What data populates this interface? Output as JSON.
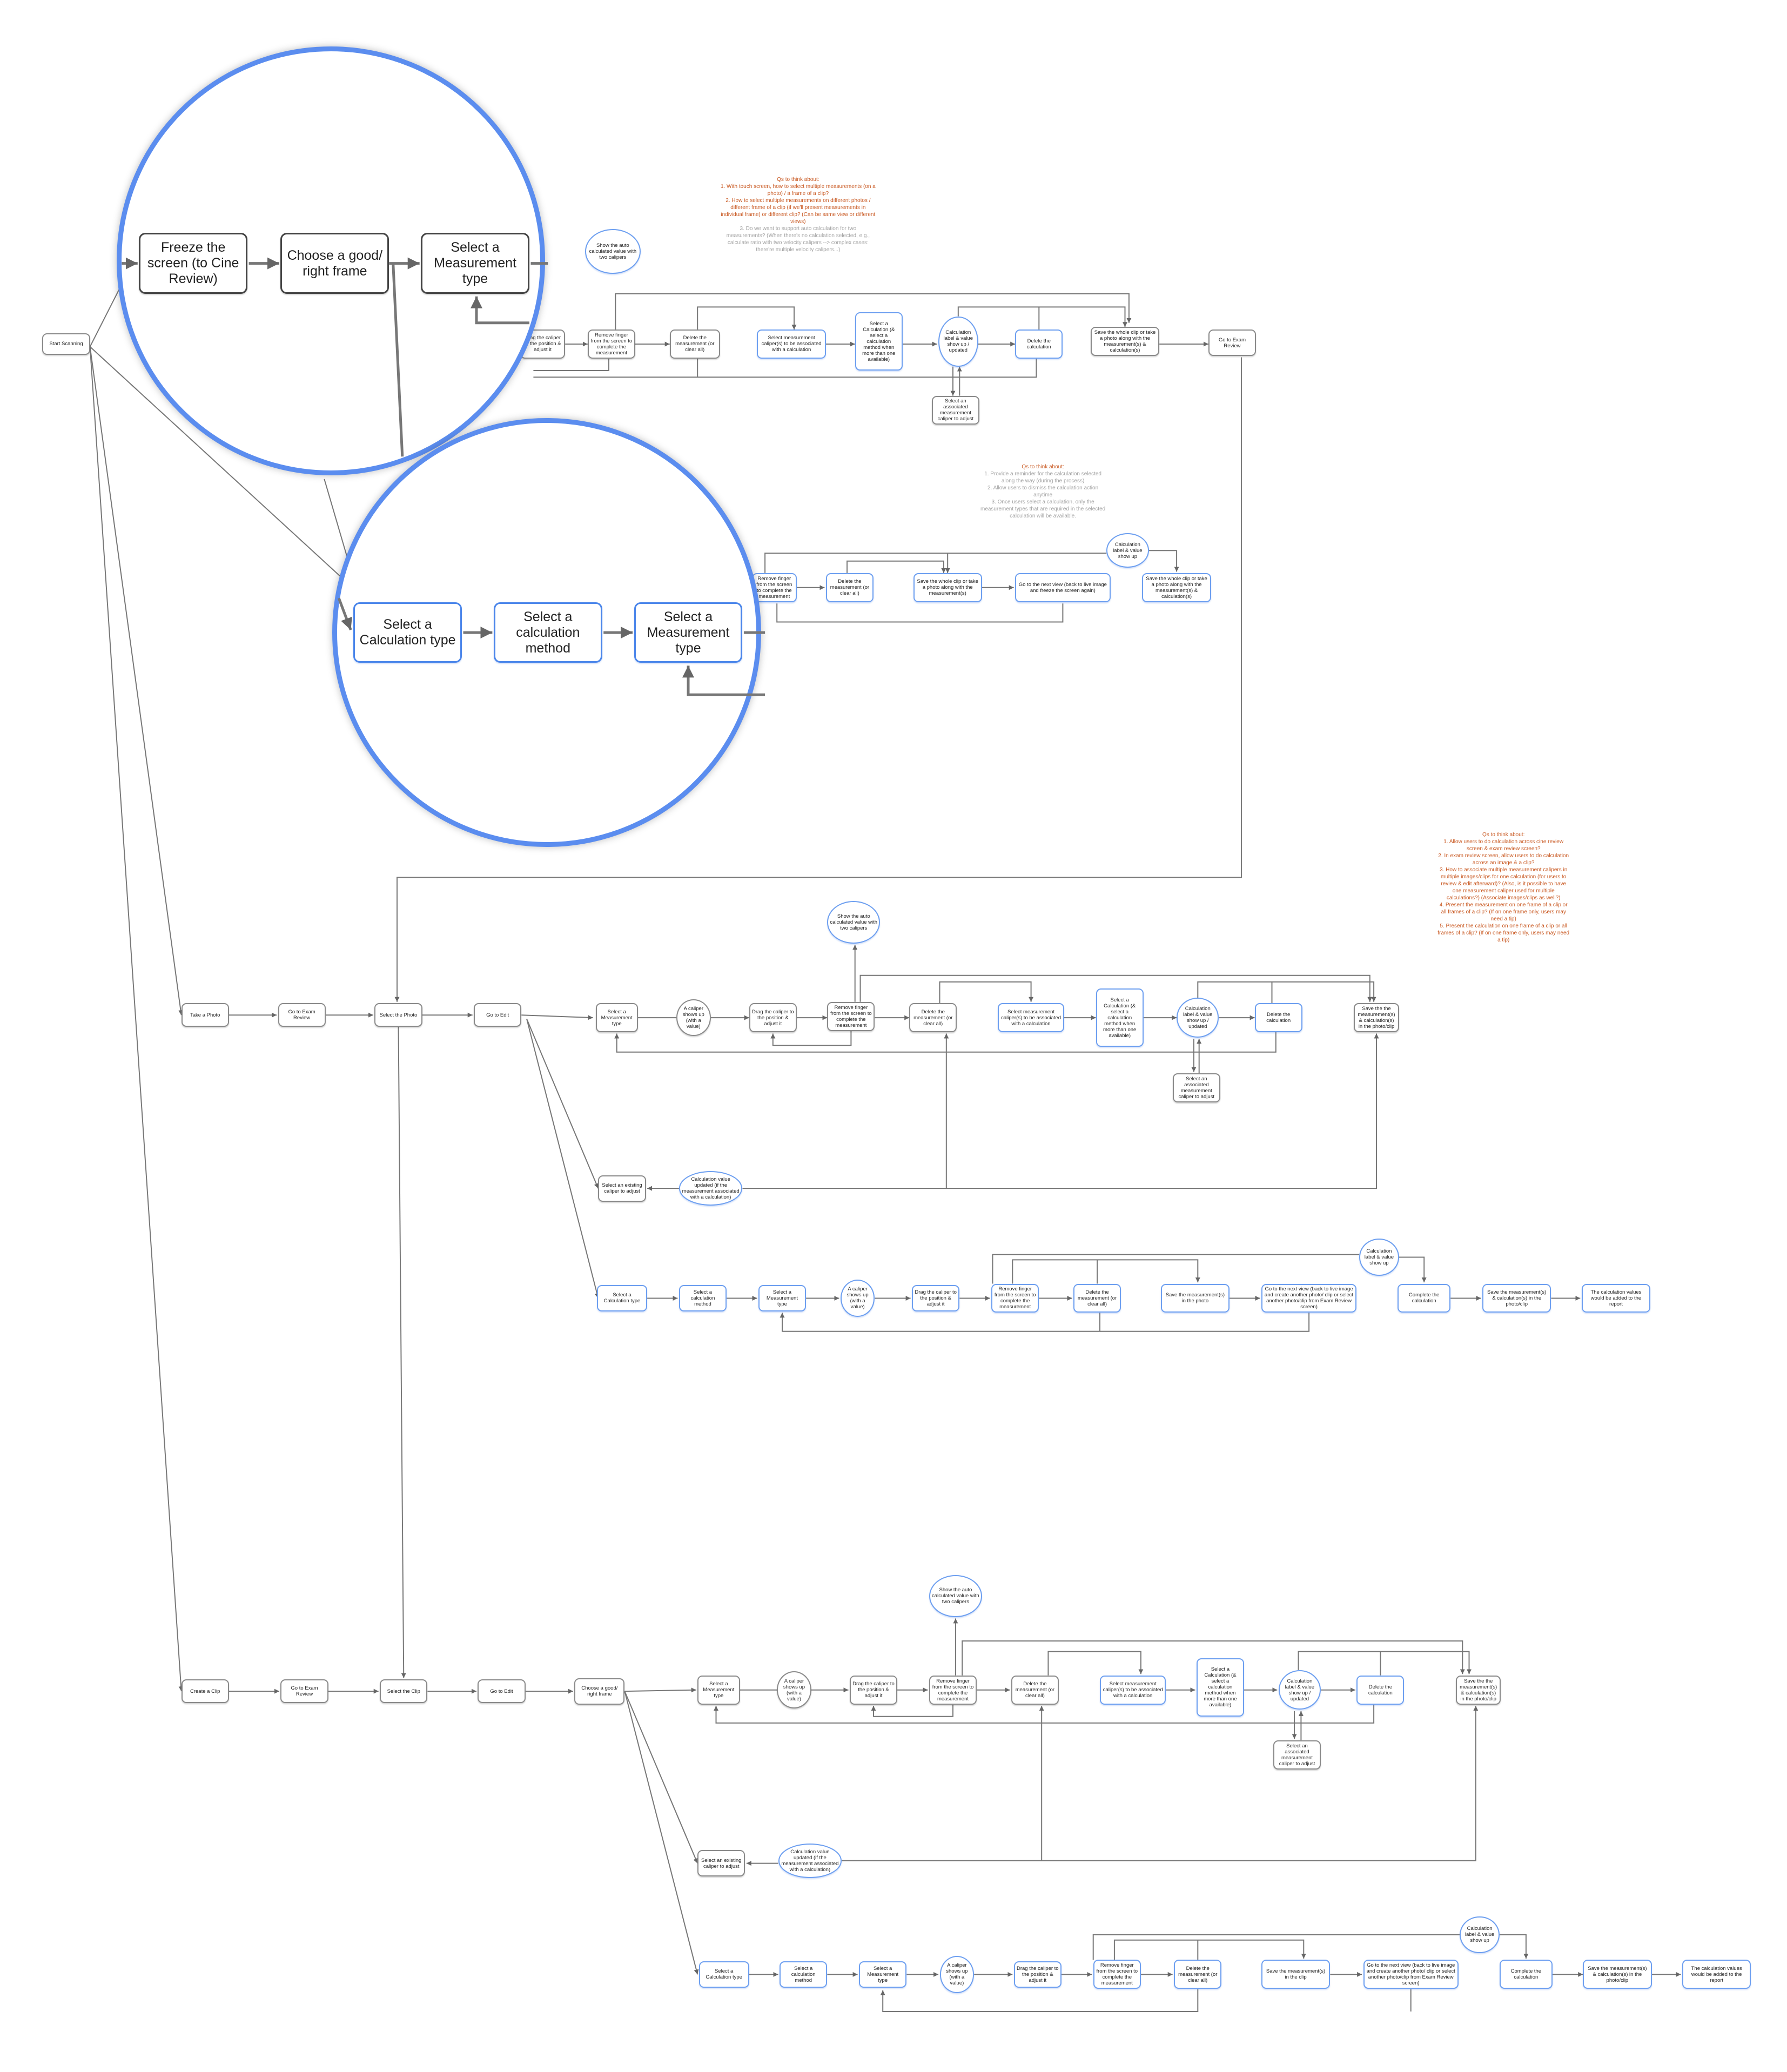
{
  "colors": {
    "lens": "#5b8def",
    "node_border": "#8a8a8a",
    "node_highlight": "#6d9ff0",
    "note_open": "#c8561e",
    "note_muted": "#a0a0a0"
  },
  "nodes": {
    "start": "Start Scanning",
    "t_drag": "Drag the caliper to the position & adjust it",
    "t_remove": "Remove finger from the screen to complete the measurement",
    "t_delete": "Delete the measurement (or clear all)",
    "t_auto": "Show the auto calculated value with two calipers",
    "t_selcal": "Select measurement caliper(s) to be associated with a calculation",
    "t_calc": "Select a Calculation (& select a calculation method when more than one available)",
    "t_label": "Calculation label & value show up / updated",
    "t_delcalc": "Delete the calculation",
    "t_save": "Save the whole clip or take a photo along with the measurement(s) & calculation(s)",
    "t_exam": "Go to Exam Review",
    "t_assoc": "Select an associated measurement caliper to adjust",
    "s_remove": "Remove finger from the screen to complete the measurement",
    "s_delete": "Delete the measurement (or clear all)",
    "s_save": "Save the whole clip or take a photo along with the measurement(s)",
    "s_next": "Go to the next view (back to live image and freeze the screen again)",
    "s_label": "Calculation label & value show up",
    "s_save2": "Save the whole clip or take a photo along with the measurement(s) & calculation(s)",
    "take_photo": "Take a Photo",
    "p_exam": "Go to Exam Review",
    "p_select": "Select the Photo",
    "p_edit": "Go to Edit",
    "p_mtype": "Select a Measurement type",
    "p_caliper": "A caliper shows up (with a value)",
    "p_drag": "Drag the caliper to the position & adjust it",
    "p_remove": "Remove finger from the screen to complete the measurement",
    "p_delete": "Delete the measurement (or clear all)",
    "p_auto": "Show the auto calculated value with two calipers",
    "p_selcal": "Select measurement caliper(s) to be associated with a calculation",
    "p_calc": "Select a Calculation (& select a calculation method when more than one available)",
    "p_label": "Calculation label & value show up / updated",
    "p_delcalc": "Delete the calculation",
    "p_save": "Save the the measurement(s) & calculation(s) in the photo/clip",
    "p_assoc": "Select an associated measurement caliper to adjust",
    "p_existing": "Select an existing caliper to adjust",
    "p_updated": "Calculation value updated (if the measurement associated with a calculation)",
    "pc_type": "Select a Calculation type",
    "pc_method": "Select a calculation method",
    "pc_mtype": "Select a Measurement type",
    "pc_caliper": "A caliper shows up (with a value)",
    "pc_drag": "Drag the caliper to the position & adjust it",
    "pc_remove": "Remove finger from the screen to complete the measurement",
    "pc_delete": "Delete the measurement (or clear all)",
    "pc_save": "Save the measurement(s) in the photo",
    "pc_next": "Go to the next view (back to live image and create another photo/ clip or select another photo/clip from Exam Review screen)",
    "pc_label": "Calculation label & value show up",
    "pc_complete": "Complete the calculation",
    "pc_save2": "Save the measurement(s) & calculation(s) in the photo/clip",
    "pc_report": "The calculation values would be added to the report",
    "create_clip": "Create a Clip",
    "c_exam": "Go to Exam Review",
    "c_select": "Select the Clip",
    "c_edit": "Go to Edit",
    "c_frame": "Choose a good/ right frame",
    "c_mtype": "Select a Measurement type",
    "c_caliper": "A caliper shows up (with a value)",
    "c_drag": "Drag the caliper to the position & adjust it",
    "c_remove": "Remove finger from the screen to complete the measurement",
    "c_delete": "Delete the measurement (or clear all)",
    "c_auto": "Show the auto calculated value with two calipers",
    "c_selcal": "Select measurement caliper(s) to be associated with a calculation",
    "c_calc": "Select a Calculation (& select a calculation method when more than one available)",
    "c_label": "Calculation label & value show up / updated",
    "c_delcalc": "Delete the calculation",
    "c_save": "Save the the measurement(s) & calculation(s) in the photo/clip",
    "c_assoc": "Select an associated measurement caliper to adjust",
    "c_existing": "Select an existing caliper to adjust",
    "c_updated": "Calculation value updated (if the measurement associated with a calculation)",
    "cc_type": "Select a Calculation type",
    "cc_method": "Select a calculation method",
    "cc_mtype": "Select a Measurement type",
    "cc_caliper": "A caliper shows up (with a value)",
    "cc_drag": "Drag the caliper to the position & adjust it",
    "cc_remove": "Remove finger from the screen to complete the measurement",
    "cc_delete": "Delete the measurement (or clear all)",
    "cc_save": "Save the measurement(s) in the clip",
    "cc_next": "Go to the next view (back to live image and create another photo/ clip or select another photo/clip from Exam Review screen)",
    "cc_label": "Calculation label & value show up",
    "cc_complete": "Complete the calculation",
    "cc_save2": "Save the measurement(s) & calculation(s) in the photo/clip",
    "cc_report": "The calculation values would be added to the report"
  },
  "zoom_nodes": {
    "z1_freeze": "Freeze the screen (to Cine Review)",
    "z1_choose": "Choose a good/ right frame",
    "z1_mtype": "Select a Measurement type",
    "z2_ctype": "Select a Calculation type",
    "z2_method": "Select a calculation method",
    "z2_mtype": "Select a Measurement type"
  },
  "notes": [
    {
      "title": "Qs to think about:",
      "items": [
        {
          "text": "1. With touch screen, how to select multiple measurements (on a photo) / a frame of a clip?",
          "status": "open"
        },
        {
          "text": "2. How to select multiple measurements on different photos / different frame of a clip (if we'll present measurements in individual frame) or different clip? (Can be same view or different views)",
          "status": "open"
        },
        {
          "text": "3. Do we want to support auto calculation for two measurements? (When there's no calculation selected, e.g., calculate ratio with two velocity calipers --> complex cases: there're multiple velocity calipers...)",
          "status": "muted"
        }
      ]
    },
    {
      "title": "Qs to think about:",
      "items": [
        {
          "text": "1. Provide a reminder for the calculation selected along the way (during the process)",
          "status": "muted"
        },
        {
          "text": "2. Allow users to dismiss the calculation action anytime",
          "status": "muted"
        },
        {
          "text": "3. Once users select a calculation, only the measurement types that are required in the selected calculation will be available.",
          "status": "muted"
        }
      ]
    },
    {
      "title": "Qs to think about:",
      "items": [
        {
          "text": "1. Allow users to do calculation across cine review screen & exam review screen?",
          "status": "open"
        },
        {
          "text": "2. In exam review screen, allow users to do calculation across an image & a clip?",
          "status": "open"
        },
        {
          "text": "3. How to associate multiple measurement calipers in multiple images/clips for one calculation (for users to review & edit afterward)? (Also, is it possible to have one measurement caliper used for multiple calculations?) (Associate images/clips as well?)",
          "status": "open"
        },
        {
          "text": "4. Present the measurement on one frame of a clip or all frames of a clip? (If on one frame only, users may need a tip)",
          "status": "open"
        },
        {
          "text": "5. Present the calculation on one frame of a clip or all frames of a clip? (If on one frame only, users may need a tip)",
          "status": "open"
        }
      ]
    }
  ]
}
